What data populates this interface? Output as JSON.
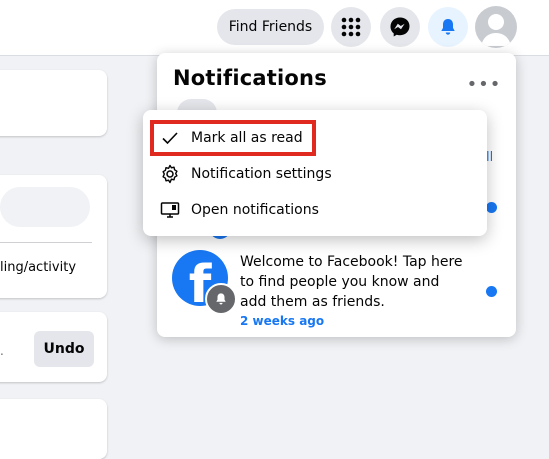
{
  "topbar": {
    "find_friends_label": "Find Friends",
    "icons": [
      "menu-grid-icon",
      "messenger-icon",
      "bell-icon",
      "profile-avatar"
    ]
  },
  "left": {
    "activity_text": "ling/activity",
    "undo_label": "Undo",
    "trailing_char": "."
  },
  "notifications": {
    "title": "Notifications",
    "more_label": "•••",
    "see_all_fragment": "ll",
    "items": [
      {
        "text": "Welcome to Facebook! Tap here to find people you know and add them as friends.",
        "time": "2 weeks ago",
        "avatar_letter": "f",
        "unread": true
      }
    ]
  },
  "menu": {
    "items": [
      {
        "label": "Mark all as read",
        "icon": "checkmark-icon",
        "highlighted": true
      },
      {
        "label": "Notification settings",
        "icon": "gear-icon",
        "highlighted": false
      },
      {
        "label": "Open notifications",
        "icon": "monitor-icon",
        "highlighted": false
      }
    ]
  },
  "colors": {
    "brand_blue": "#1877f2",
    "highlight_red": "#e02a20",
    "background": "#f0f2f5"
  }
}
